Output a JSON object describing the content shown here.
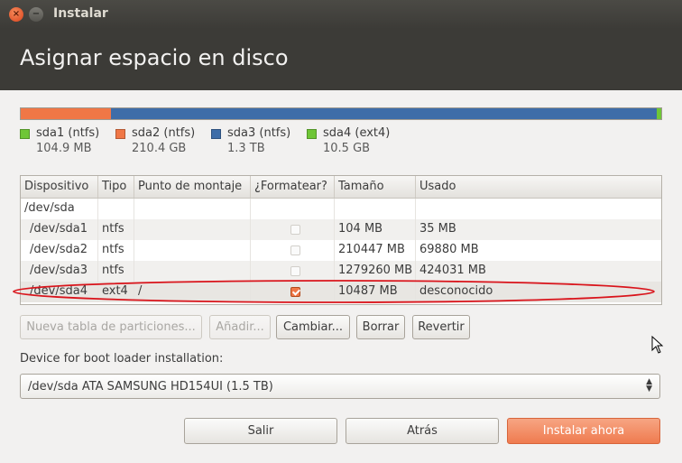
{
  "window": {
    "title": "Instalar",
    "close_glyph": "×",
    "min_glyph": "−"
  },
  "page": {
    "title": "Asignar espacio en disco"
  },
  "colors": {
    "ntfs_orange": "#f07746",
    "ntfs_blue": "#3e6da8",
    "ext4_green": "#6fc636",
    "primary_button": "#ef7b4f"
  },
  "partition_bar": {
    "segments": [
      {
        "name": "sda1",
        "color": "#6fc636",
        "fraction": 0.0001
      },
      {
        "name": "sda2",
        "color": "#f07746",
        "fraction": 0.141
      },
      {
        "name": "sda3",
        "color": "#3e6da8",
        "fraction": 0.852
      },
      {
        "name": "sda4",
        "color": "#6fc636",
        "fraction": 0.007
      }
    ]
  },
  "legend": [
    {
      "name": "sda1 (ntfs)",
      "size": "104.9 MB",
      "color": "#6fc636"
    },
    {
      "name": "sda2 (ntfs)",
      "size": "210.4 GB",
      "color": "#f07746"
    },
    {
      "name": "sda3 (ntfs)",
      "size": "1.3 TB",
      "color": "#3e6da8"
    },
    {
      "name": "sda4 (ext4)",
      "size": "10.5 GB",
      "color": "#6fc636"
    }
  ],
  "table": {
    "headers": [
      "Dispositivo",
      "Tipo",
      "Punto de montaje",
      "¿Formatear?",
      "Tamaño",
      "Usado"
    ],
    "rows": [
      {
        "device": "/dev/sda",
        "type": "",
        "mount": "",
        "format": null,
        "size": "",
        "used": ""
      },
      {
        "device": "/dev/sda1",
        "type": "ntfs",
        "mount": "",
        "format": false,
        "size": "104 MB",
        "used": "35 MB"
      },
      {
        "device": "/dev/sda2",
        "type": "ntfs",
        "mount": "",
        "format": false,
        "size": "210447 MB",
        "used": "69880 MB"
      },
      {
        "device": "/dev/sda3",
        "type": "ntfs",
        "mount": "",
        "format": false,
        "size": "1279260 MB",
        "used": "424031 MB"
      },
      {
        "device": "/dev/sda4",
        "type": "ext4",
        "mount": "/",
        "format": true,
        "size": "10487 MB",
        "used": "desconocido"
      }
    ]
  },
  "actions": {
    "new_table": "Nueva tabla de particiones...",
    "add": "Añadir...",
    "change": "Cambiar...",
    "delete": "Borrar",
    "revert": "Revertir"
  },
  "bootloader": {
    "label": "Device for boot loader installation:",
    "selected": "/dev/sda ATA SAMSUNG HD154UI (1.5 TB)",
    "arrow_up": "▲",
    "arrow_down": "▼"
  },
  "footer": {
    "quit": "Salir",
    "back": "Atrás",
    "install": "Instalar ahora"
  }
}
